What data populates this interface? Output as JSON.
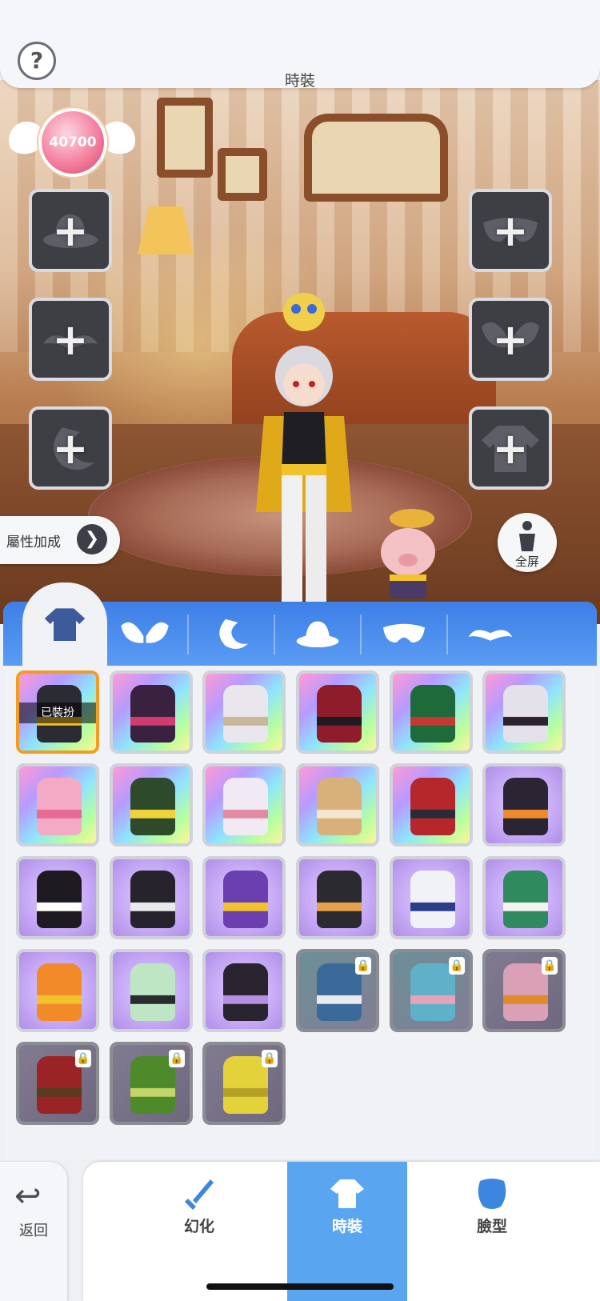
{
  "header": {
    "title": "時裝",
    "help_label": "?"
  },
  "currency": {
    "value": "40700"
  },
  "scene_buttons": {
    "attr_label": "屬性加成",
    "fullscreen_label": "全屏"
  },
  "left_slots": [
    {
      "name": "hat-slot",
      "icon": "hat-icon",
      "label": "+"
    },
    {
      "name": "mustache-slot",
      "icon": "mustache-icon",
      "label": "+"
    },
    {
      "name": "tail-slot",
      "icon": "tail-icon",
      "label": "+"
    }
  ],
  "right_slots": [
    {
      "name": "mask-slot",
      "icon": "mask-icon",
      "label": "+"
    },
    {
      "name": "wings-slot",
      "icon": "wings-icon",
      "label": "+"
    },
    {
      "name": "outfit-slot",
      "icon": "jacket-icon",
      "label": "+"
    }
  ],
  "category_tabs": [
    {
      "name": "tab-outfit",
      "icon": "jacket-icon",
      "active": true
    },
    {
      "name": "tab-wings",
      "icon": "wings-icon",
      "active": false
    },
    {
      "name": "tab-tail",
      "icon": "tail-icon",
      "active": false
    },
    {
      "name": "tab-hat",
      "icon": "hat-icon",
      "active": false
    },
    {
      "name": "tab-mask",
      "icon": "mask-icon",
      "active": false
    },
    {
      "name": "tab-mustache",
      "icon": "mustache-icon",
      "active": false
    }
  ],
  "equipped_badge": "已裝扮",
  "outfits": [
    {
      "color": "#2b2b33",
      "accent": "#f2c22b",
      "bg": "rainbow",
      "state": "equipped"
    },
    {
      "color": "#3a2140",
      "accent": "#d23b6d",
      "bg": "rainbow",
      "state": "owned"
    },
    {
      "color": "#e9e6ee",
      "accent": "#c8b89a",
      "bg": "rainbow",
      "state": "owned"
    },
    {
      "color": "#8e1c2a",
      "accent": "#1f1a22",
      "bg": "rainbow",
      "state": "owned"
    },
    {
      "color": "#1f6a3a",
      "accent": "#c33a32",
      "bg": "rainbow",
      "state": "owned"
    },
    {
      "color": "#e5e1ea",
      "accent": "#2c2230",
      "bg": "rainbow",
      "state": "owned"
    },
    {
      "color": "#f4a9c4",
      "accent": "#e66a95",
      "bg": "rainbow",
      "state": "owned"
    },
    {
      "color": "#2d4b2a",
      "accent": "#f2d23a",
      "bg": "rainbow",
      "state": "owned"
    },
    {
      "color": "#f1e9f4",
      "accent": "#e58aa5",
      "bg": "rainbow",
      "state": "owned"
    },
    {
      "color": "#d7b07a",
      "accent": "#f3e6cf",
      "bg": "rainbow",
      "state": "owned"
    },
    {
      "color": "#b5272b",
      "accent": "#2b2b38",
      "bg": "rainbow",
      "state": "owned"
    },
    {
      "color": "#2a2433",
      "accent": "#ef8a2a",
      "bg": "purple",
      "state": "owned"
    },
    {
      "color": "#1e1a22",
      "accent": "#ffffff",
      "bg": "purple",
      "state": "owned"
    },
    {
      "color": "#26232c",
      "accent": "#e9e9ee",
      "bg": "purple",
      "state": "owned"
    },
    {
      "color": "#6a3fb0",
      "accent": "#f2c22b",
      "bg": "purple",
      "state": "owned"
    },
    {
      "color": "#2a2a30",
      "accent": "#e6a24a",
      "bg": "purple",
      "state": "owned"
    },
    {
      "color": "#f1f2f6",
      "accent": "#2a3c8a",
      "bg": "purple",
      "state": "owned"
    },
    {
      "color": "#2f8a5e",
      "accent": "#f3f3f3",
      "bg": "purple",
      "state": "owned"
    },
    {
      "color": "#f28a2a",
      "accent": "#f2c22b",
      "bg": "purple",
      "state": "owned"
    },
    {
      "color": "#bfe6c4",
      "accent": "#2a2a30",
      "bg": "purple",
      "state": "owned"
    },
    {
      "color": "#2a2330",
      "accent": "#b58fe0",
      "bg": "purple",
      "state": "owned"
    },
    {
      "color": "#3a6a9a",
      "accent": "#e9e9ee",
      "bg": "teal",
      "state": "locked"
    },
    {
      "color": "#5fb1c9",
      "accent": "#e6a4b8",
      "bg": "teal",
      "state": "locked"
    },
    {
      "color": "#d9a0b6",
      "accent": "#e08a2a",
      "bg": "lilac",
      "state": "locked"
    },
    {
      "color": "#9a2326",
      "accent": "#5a3a20",
      "bg": "lilac",
      "state": "locked"
    },
    {
      "color": "#4c8a2a",
      "accent": "#c2d46a",
      "bg": "lilac",
      "state": "locked"
    },
    {
      "color": "#e3d23a",
      "accent": "#b5a12a",
      "bg": "lilac",
      "state": "locked"
    }
  ],
  "bottom_nav": {
    "back_label": "返回",
    "items": [
      {
        "name": "nav-transform",
        "label": "幻化",
        "icon": "sword-icon",
        "active": false
      },
      {
        "name": "nav-fashion",
        "label": "時裝",
        "icon": "outfit-icon",
        "active": true
      },
      {
        "name": "nav-face",
        "label": "臉型",
        "icon": "face-icon",
        "active": false
      }
    ]
  }
}
